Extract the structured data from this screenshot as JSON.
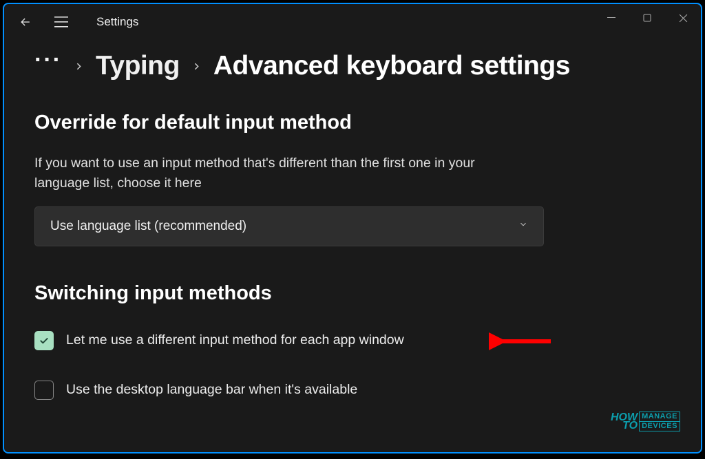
{
  "app": {
    "title": "Settings"
  },
  "breadcrumb": {
    "typing": "Typing",
    "current": "Advanced keyboard settings"
  },
  "override_section": {
    "title": "Override for default input method",
    "description": "If you want to use an input method that's different than the first one in your language list, choose it here",
    "select_value": "Use language list (recommended)"
  },
  "switching_section": {
    "title": "Switching input methods",
    "options": [
      {
        "label": "Let me use a different input method for each app window",
        "checked": true
      },
      {
        "label": "Use the desktop language bar when it's available",
        "checked": false
      }
    ]
  },
  "watermark": {
    "line1": "HOW",
    "line2": "TO",
    "box1": "MANAGE",
    "box2": "DEVICES"
  }
}
